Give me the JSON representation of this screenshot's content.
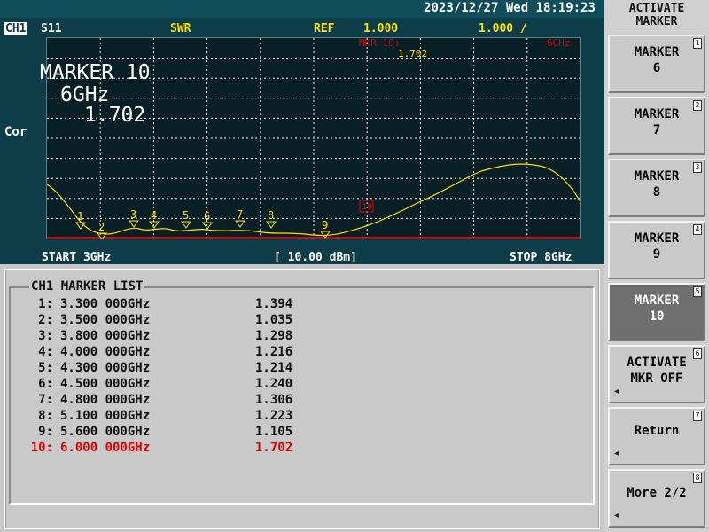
{
  "header": {
    "channel": "CH1",
    "parameter": "S11",
    "format": "SWR",
    "ref_label": "REF",
    "ref_value": "1.000",
    "scale": "1.000 /",
    "datetime": "2023/12/27 Wed 18:19:23"
  },
  "trace": {
    "cor": "Cor",
    "active_marker_name": "MARKER 10",
    "active_marker_freq": "6GHz",
    "active_marker_value": "1.702",
    "marker_header": "MKR 10:",
    "marker_header_freq": "6GHz",
    "marker_header_value": "1.702",
    "start": "START 3GHz",
    "power": "[ 10.00 dBm]",
    "stop": "STOP 8GHz",
    "marker_labels": [
      "1",
      "2",
      "3",
      "4",
      "5",
      "6",
      "7",
      "8",
      "9",
      "10"
    ],
    "marker_points": [
      {
        "x": 3.3,
        "y": 1.394
      },
      {
        "x": 3.5,
        "y": 1.035
      },
      {
        "x": 3.8,
        "y": 1.298
      },
      {
        "x": 4.0,
        "y": 1.216
      },
      {
        "x": 4.3,
        "y": 1.214
      },
      {
        "x": 4.5,
        "y": 1.24
      },
      {
        "x": 4.8,
        "y": 1.306
      },
      {
        "x": 5.1,
        "y": 1.223
      },
      {
        "x": 5.6,
        "y": 1.105
      },
      {
        "x": 6.0,
        "y": 1.702
      }
    ]
  },
  "marker_list": {
    "title": "CH1 MARKER LIST",
    "rows": [
      {
        "idx": "1:",
        "freq": "3.300 000GHz",
        "value": "1.394"
      },
      {
        "idx": "2:",
        "freq": "3.500 000GHz",
        "value": "1.035"
      },
      {
        "idx": "3:",
        "freq": "3.800 000GHz",
        "value": "1.298"
      },
      {
        "idx": "4:",
        "freq": "4.000 000GHz",
        "value": "1.216"
      },
      {
        "idx": "5:",
        "freq": "4.300 000GHz",
        "value": "1.214"
      },
      {
        "idx": "6:",
        "freq": "4.500 000GHz",
        "value": "1.240"
      },
      {
        "idx": "7:",
        "freq": "4.800 000GHz",
        "value": "1.306"
      },
      {
        "idx": "8:",
        "freq": "5.100 000GHz",
        "value": "1.223"
      },
      {
        "idx": "9:",
        "freq": "5.600 000GHz",
        "value": "1.105"
      },
      {
        "idx": "10:",
        "freq": "6.000 000GHz",
        "value": "1.702"
      }
    ]
  },
  "softkeys": {
    "title_line1": "ACTIVATE",
    "title_line2": "MARKER",
    "keys": [
      {
        "num": "1",
        "line1": "MARKER",
        "line2": "6"
      },
      {
        "num": "2",
        "line1": "MARKER",
        "line2": "7"
      },
      {
        "num": "3",
        "line1": "MARKER",
        "line2": "8"
      },
      {
        "num": "4",
        "line1": "MARKER",
        "line2": "9"
      },
      {
        "num": "5",
        "line1": "MARKER",
        "line2": "10"
      },
      {
        "num": "6",
        "line1": "ACTIVATE",
        "line2": "MKR OFF"
      },
      {
        "num": "7",
        "line1": "Return",
        "line2": ""
      },
      {
        "num": "8",
        "line1": "More 2/2",
        "line2": ""
      }
    ]
  },
  "colors": {
    "screen_bg": "#0d3d48",
    "plot_bg": "#081f26",
    "trace": "#ffe000",
    "grid": "#ffffff",
    "alert_red": "#e00000"
  },
  "icons": {
    "softkey_arrow": "triangle-left-icon"
  }
}
